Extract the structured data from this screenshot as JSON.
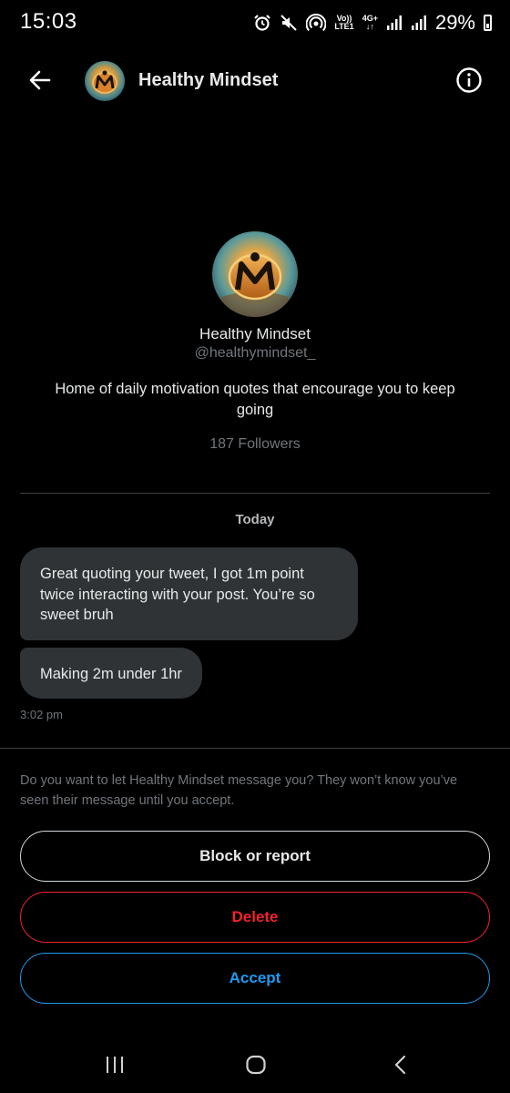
{
  "status_bar": {
    "time": "15:03",
    "net_top": "Vo))",
    "net_bottom": "LTE1",
    "net_gen": "4G+",
    "battery": "29%"
  },
  "header": {
    "title": "Healthy Mindset",
    "back_icon": "back-arrow-icon",
    "info_icon": "info-icon"
  },
  "profile": {
    "name": "Healthy Mindset",
    "handle": "@healthymindset_",
    "bio": "Home of daily motivation quotes that encourage you to keep going",
    "followers": "187 Followers"
  },
  "conversation": {
    "date_label": "Today",
    "messages": [
      {
        "text": "Great quoting your tweet, I got 1m point twice interacting with your post. You’re so sweet bruh"
      },
      {
        "text": "Making 2m under 1hr"
      }
    ],
    "last_time": "3:02 pm"
  },
  "request": {
    "prompt": "Do you want to let Healthy Mindset message you? They won’t know you’ve seen their message until you accept.",
    "block_label": "Block or report",
    "delete_label": "Delete",
    "accept_label": "Accept"
  },
  "colors": {
    "background": "#000000",
    "bubble": "#2f3336",
    "muted": "#71767b",
    "delete": "#f4212e",
    "accept": "#1d9bf0"
  }
}
